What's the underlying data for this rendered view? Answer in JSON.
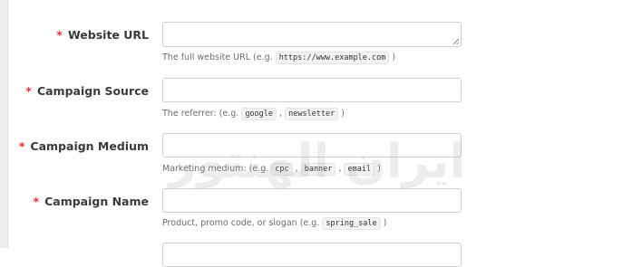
{
  "fields": [
    {
      "label": "Website URL",
      "required_mark": "*",
      "help_prefix": "The full website URL (e.g. ",
      "codes": [
        "https://www.example.com"
      ],
      "help_suffix": " )"
    },
    {
      "label": "Campaign Source",
      "required_mark": "*",
      "help_prefix": "The referrer: (e.g. ",
      "codes": [
        "google",
        "newsletter"
      ],
      "help_suffix": " )"
    },
    {
      "label": "Campaign Medium",
      "required_mark": "*",
      "help_prefix": "Marketing medium: (e.g. ",
      "codes": [
        "cpc",
        "banner",
        "email"
      ],
      "help_suffix": " )"
    },
    {
      "label": "Campaign Name",
      "required_mark": "*",
      "help_prefix": "Product, promo code, or slogan (e.g. ",
      "codes": [
        "spring_sale"
      ],
      "help_suffix": " )"
    }
  ],
  "watermark": "ایران ‌ الهنتور",
  "colors": {
    "required": "#d9323a",
    "watermark": "#9aa0a6"
  }
}
